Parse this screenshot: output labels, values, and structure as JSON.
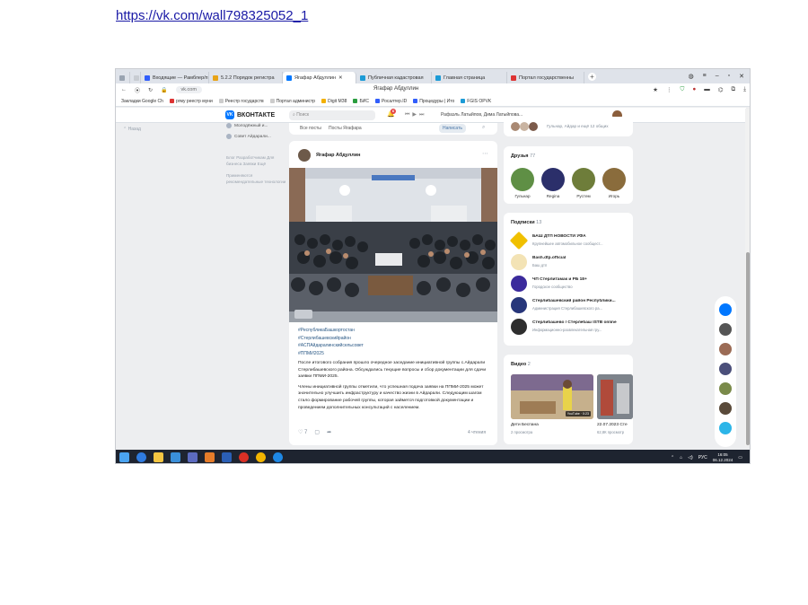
{
  "document": {
    "link_text": "https://vk.com/wall798325052_1"
  },
  "browser": {
    "tabs": [
      "Входящие — Рамблер/п",
      "5.2.2 Порядок регистра",
      "Ягафар Абдуллин",
      "Публичная кадастровая",
      "Главная страница",
      "Портал государственны"
    ],
    "url": "vk.com",
    "page_title": "Ягафар Абдуллин",
    "bookmarks": [
      "Закладки Google Ch",
      "ргму реестр муни",
      "Реестр государств",
      "Портал администр",
      "Digit МЗ8",
      "БИС",
      "Росалтер.ID",
      "Процедуры | Ито",
      "FGIS OPVK"
    ]
  },
  "vk": {
    "logo_text": "ВКОНТАКТЕ",
    "search_placeholder": "Поиск",
    "notification_count": "6",
    "now_playing": "Рафаэль Латыйпов, Дима Латыйпова...",
    "left_back": "Назад",
    "sidebar_groups": [
      "Молодёжный и...",
      "Совет Айдарали..."
    ],
    "sidebar_footer": "Блог   Разработчикам Для бизнеса   Заявки Ещё",
    "sidebar_reco": "Применяются рекомендательные технологии",
    "feed_tabs": [
      "Все посты",
      "Посты Ягафара"
    ],
    "write_button": "Написать"
  },
  "post": {
    "author": "Ягафар Абдуллин",
    "hashtags": [
      "#РеспубликаБашкортостан",
      "#Стерлибашевскийрайон",
      "#АСПАйдаралинскийсельсовет",
      "#ППМИ2025"
    ],
    "paragraph1": "После итогового собрания прошло очередное заседание инициативной группы с.Айдарали Стерлибашевского района. Обсуждались текущие вопросы и сбор документации для сдачи заявки ППМИ-2025.",
    "paragraph2": "Члены инициативной группы отметили, что успешная подача заявки на ППМИ-2025 может значительно улучшить инфраструктуру и качество жизни в Айдарали. Следующим шагом стало формирование рабочей группы, которая займется подготовкой документации и проведением дополнительных консультаций с населением.",
    "likes": "7",
    "views": "4 чтения"
  },
  "right": {
    "top_text": "Гульнар, Айдар и ещё 12 общих",
    "friends_title": "Друзья",
    "friends_count": "77",
    "friends": [
      "Гульнар",
      "Regina",
      "Рустем",
      "Игорь"
    ],
    "subs_title": "Подписки",
    "subs_count": "13",
    "subscriptions": [
      {
        "name": "БАШ ДТП НОВОСТИ УФА",
        "desc": "Крупнейшее автомобильное сообщест..."
      },
      {
        "name": "Bash.dtp.official",
        "desc": "Баш дтп"
      },
      {
        "name": "ЧП Стерлитамак и РБ 18+",
        "desc": "Городское сообщество"
      },
      {
        "name": "Стерлибашевский район Республики...",
        "desc": "Администрация Стерлибашевского ра..."
      },
      {
        "name": "Стерлибашево / Стерлебаш ISTB online",
        "desc": "Информационно-развлекательная гру..."
      }
    ],
    "videos_title": "Видео",
    "videos_count": "2",
    "videos": [
      {
        "title": "Дети Беспана",
        "meta": "2 просмотра",
        "badge": "YouTube · 0:23"
      },
      {
        "title": "22.07.2023 Сте",
        "meta": "62,8К просмотр",
        "badge": ""
      }
    ]
  },
  "taskbar": {
    "tray_lang": "РУС",
    "time": "16:05",
    "date": "06.12.2024"
  },
  "colors": {
    "vk_blue": "#0077ff",
    "link": "#2a5885",
    "taskbar": "#1e2430"
  }
}
